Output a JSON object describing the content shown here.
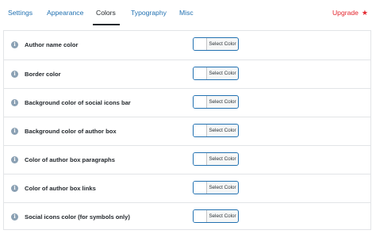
{
  "tabs": [
    {
      "label": "Settings",
      "active": false
    },
    {
      "label": "Appearance",
      "active": false
    },
    {
      "label": "Colors",
      "active": true
    },
    {
      "label": "Typography",
      "active": false
    },
    {
      "label": "Misc",
      "active": false
    }
  ],
  "upgrade": {
    "label": "Upgrade",
    "icon": "star-icon",
    "color": "#e3262e"
  },
  "accent_color": "#2271b1",
  "settings": [
    {
      "label": "Author name color",
      "button": "Select Color"
    },
    {
      "label": "Border color",
      "button": "Select Color"
    },
    {
      "label": "Background color of social icons bar",
      "button": "Select Color"
    },
    {
      "label": "Background color of author box",
      "button": "Select Color"
    },
    {
      "label": "Color of author box paragraphs",
      "button": "Select Color"
    },
    {
      "label": "Color of author box links",
      "button": "Select Color"
    },
    {
      "label": "Social icons color (for symbols only)",
      "button": "Select Color"
    }
  ]
}
